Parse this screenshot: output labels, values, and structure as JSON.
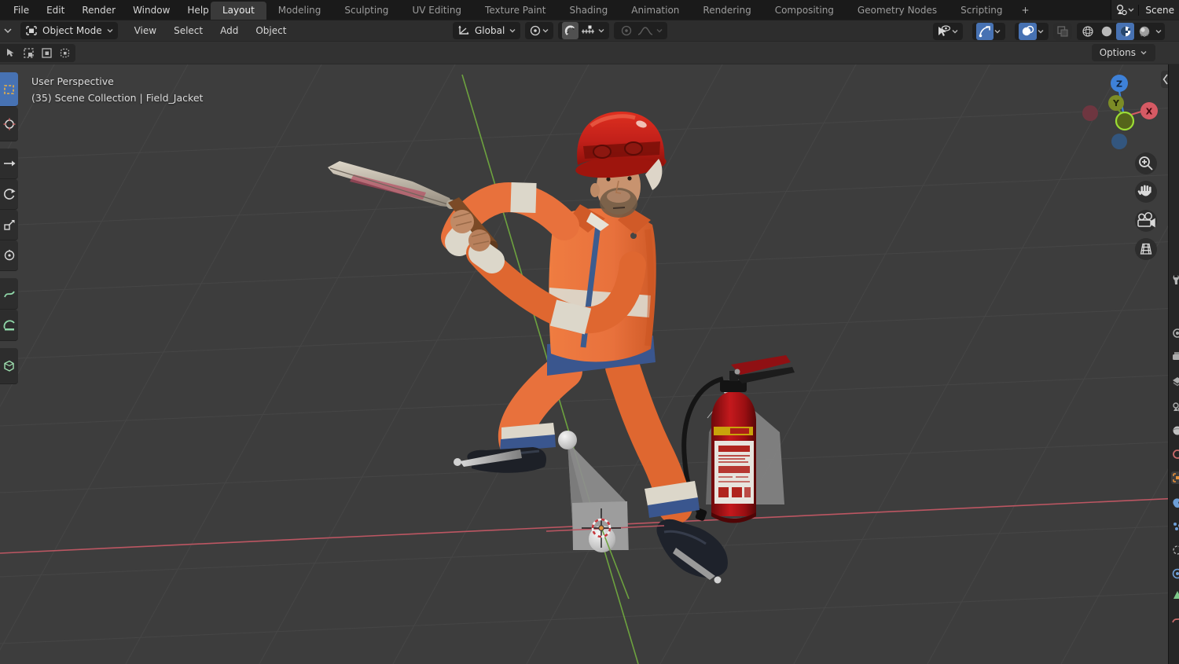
{
  "topbar": {
    "menus": [
      "File",
      "Edit",
      "Render",
      "Window",
      "Help"
    ],
    "workspace_tabs": [
      "Layout",
      "Modeling",
      "Sculpting",
      "UV Editing",
      "Texture Paint",
      "Shading",
      "Animation",
      "Rendering",
      "Compositing",
      "Geometry Nodes",
      "Scripting"
    ],
    "active_tab": "Layout",
    "add_workspace_label": "+",
    "scene_selector_label": "Scene"
  },
  "viewport_header": {
    "mode_label": "Object Mode",
    "menus": [
      "View",
      "Select",
      "Add",
      "Object"
    ],
    "transform_orientation_label": "Global"
  },
  "tool_settings": {
    "options_label": "Options"
  },
  "viewport": {
    "overlay": {
      "view_name": "User Perspective",
      "breadcrumb": "(35) Scene Collection | Field_Jacket"
    },
    "nav_gizmo_axes": {
      "x": "X",
      "y": "Y",
      "z": "Z"
    }
  },
  "scene_objects": {
    "character": "construction worker in orange hi-vis suit with red hard hat holding a sword",
    "prop": "red fire extinguisher with black hose",
    "lights": "two point/spot light gizmos with grey cones",
    "cursor": "3D cursor at scene origin"
  },
  "colors": {
    "accent_blue": "#4772b3",
    "viewport_background": "#3d3d3d",
    "axis_x_red": "#bc5662",
    "axis_y_green": "#6da23f",
    "suit_orange": "#e8713c",
    "helmet_red": "#c1251b",
    "extinguisher_red": "#a31016"
  },
  "icons": {
    "chevron_down": "small down chevron",
    "editor_type": "viewport editor icon",
    "magnet_snap": "magnet",
    "zoom": "magnifier with plus",
    "pan": "hand",
    "camera_view": "movie camera",
    "ortho_toggle": "perspective grid"
  }
}
